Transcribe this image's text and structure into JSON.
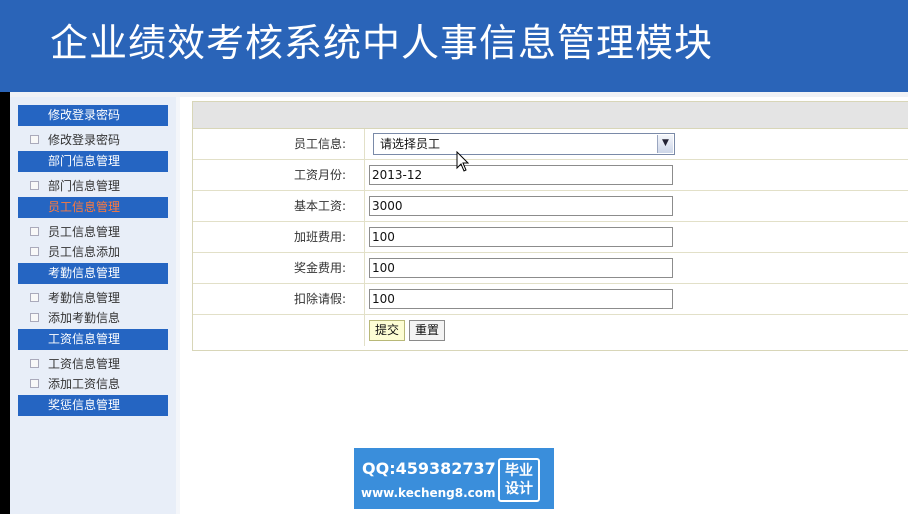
{
  "header": {
    "title": "企业绩效考核系统中人事信息管理模块"
  },
  "sidebar": {
    "sections": [
      {
        "label": "修改登录密码",
        "active": false,
        "items": [
          "修改登录密码"
        ]
      },
      {
        "label": "部门信息管理",
        "active": false,
        "items": [
          "部门信息管理"
        ]
      },
      {
        "label": "员工信息管理",
        "active": true,
        "items": [
          "员工信息管理",
          "员工信息添加"
        ]
      },
      {
        "label": "考勤信息管理",
        "active": false,
        "items": [
          "考勤信息管理",
          "添加考勤信息"
        ]
      },
      {
        "label": "工资信息管理",
        "active": false,
        "items": [
          "工资信息管理",
          "添加工资信息"
        ]
      },
      {
        "label": "奖惩信息管理",
        "active": false,
        "items": []
      }
    ]
  },
  "form": {
    "employee": {
      "label": "员工信息:",
      "selected": "请选择员工"
    },
    "month": {
      "label": "工资月份:",
      "value": "2013-12"
    },
    "base_salary": {
      "label": "基本工资:",
      "value": "3000"
    },
    "overtime": {
      "label": "加班费用:",
      "value": "100"
    },
    "bonus": {
      "label": "奖金费用:",
      "value": "100"
    },
    "deduction": {
      "label": "扣除请假:",
      "value": "100"
    },
    "submit_label": "提交",
    "reset_label": "重置"
  },
  "watermark": {
    "qq": "QQ:459382737",
    "url": "www.kecheng8.com",
    "badge_line1": "毕业",
    "badge_line2": "设计"
  },
  "colors": {
    "header_bg": "#2a64b8",
    "menu_header_bg": "#2565c2",
    "active_menu_text": "#ff7a3c",
    "sidebar_bg": "#e8eef8"
  }
}
